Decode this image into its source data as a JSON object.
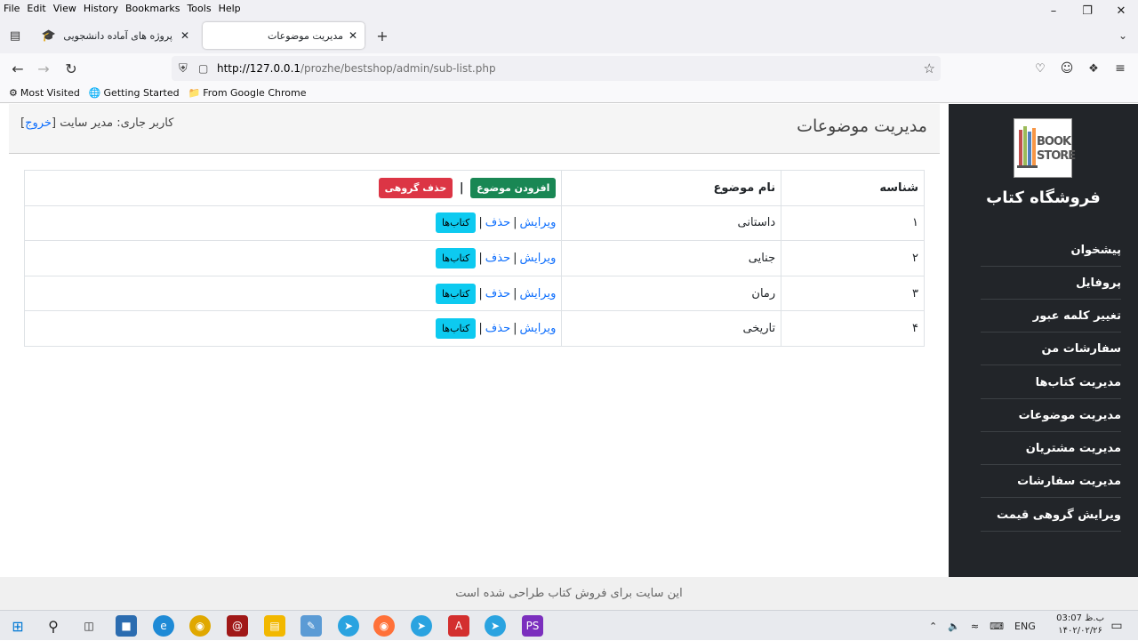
{
  "browser": {
    "menu": [
      "File",
      "Edit",
      "View",
      "History",
      "Bookmarks",
      "Tools",
      "Help"
    ],
    "tabs": [
      {
        "title": "پروژه های آماده دانشجویی",
        "active": false
      },
      {
        "title": "مدیریت موضوعات",
        "active": true
      }
    ],
    "url_base": "http://127.0.0.1",
    "url_path": "/prozhe/bestshop/admin/sub-list.php",
    "bookmarks": [
      "Most Visited",
      "Getting Started",
      "From Google Chrome"
    ]
  },
  "sidebar": {
    "logo_line1": "BOOK",
    "logo_line2": "STORE",
    "brand": "فروشگاه کتاب",
    "items": [
      "پیشخوان",
      "پروفایل",
      "تغییر کلمه عبور",
      "سفارشات من",
      "مدیریت کتاب‌ها",
      "مدیریت موضوعات",
      "مدیریت مشتریان",
      "مدیریت سفارشات",
      "ویرایش گروهی قیمت"
    ]
  },
  "header": {
    "title": "مدیریت موضوعات",
    "user_label": "کاربر جاری: مدیر سایت",
    "logout": "خروج"
  },
  "table": {
    "col_id": "شناسه",
    "col_name": "نام موضوع",
    "add_button": "افزودن موضوع",
    "bulk_delete_button": "حذف گروهی",
    "edit": "ویرایش",
    "delete": "حذف",
    "books": "کتاب‌ها",
    "rows": [
      {
        "id": "۱",
        "name": "داستانی"
      },
      {
        "id": "۲",
        "name": "جنایی"
      },
      {
        "id": "۳",
        "name": "رمان"
      },
      {
        "id": "۴",
        "name": "تاریخی"
      }
    ]
  },
  "footer": "این سایت برای فروش کتاب طراحی شده است",
  "taskbar": {
    "lang": "ENG",
    "time": "03:07 ب.ظ",
    "date": "۱۴۰۲/۰۲/۲۶"
  },
  "colors": {
    "sidebar_bg": "#222529",
    "green": "#198754",
    "red": "#dc3545",
    "cyan": "#0dcaf0",
    "link": "#0d6efd"
  }
}
